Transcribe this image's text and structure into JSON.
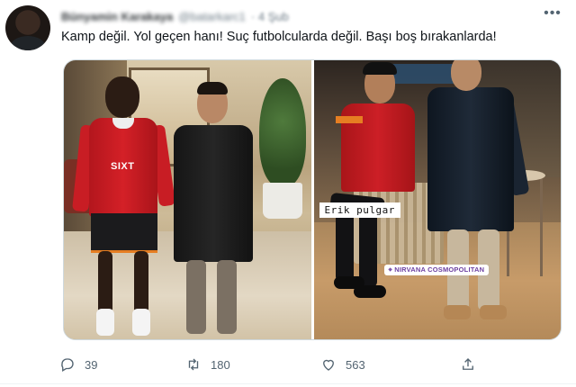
{
  "tweet": {
    "display_name": "Bünyamin Karakaya",
    "handle": "@batarkarc1",
    "time": "· 4 Şub",
    "more_icon": "more-dots-icon",
    "text": "Kamp değil. Yol geçen hanı!  Suç futbolcularda değil. Başı boş bırakanlarda!"
  },
  "media": {
    "photo1": {
      "jersey_logo": "SIXT"
    },
    "photo2": {
      "name_caption": "Erik pulgar",
      "location_sticker": "⌖ NIRVANA COSMOPOLITAN"
    }
  },
  "actions": {
    "reply": {
      "icon": "reply-icon",
      "count": "39"
    },
    "retweet": {
      "icon": "retweet-icon",
      "count": "180"
    },
    "like": {
      "icon": "heart-icon",
      "count": "563"
    },
    "share": {
      "icon": "share-icon"
    }
  }
}
